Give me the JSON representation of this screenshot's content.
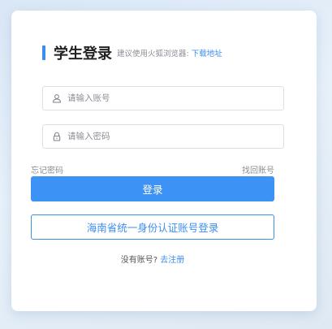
{
  "login": {
    "title": "学生登录",
    "browser_hint": "建议使用火狐浏览器:",
    "download_link": "下载地址",
    "account_placeholder": "请输入账号",
    "password_placeholder": "请输入密码",
    "forgot_password": "忘记密码",
    "retrieve_account": "找回账号",
    "login_button": "登录",
    "unified_login_button": "海南省统一身份认证账号登录",
    "no_account_prompt": "没有账号?",
    "register_link": "去注册"
  },
  "icons": {
    "account": "user-icon",
    "password": "lock-icon"
  },
  "colors": {
    "accent": "#3c8eed",
    "primary_button": "#3d92f5",
    "background": "#e3edf7",
    "muted_text": "#8a8f96"
  }
}
